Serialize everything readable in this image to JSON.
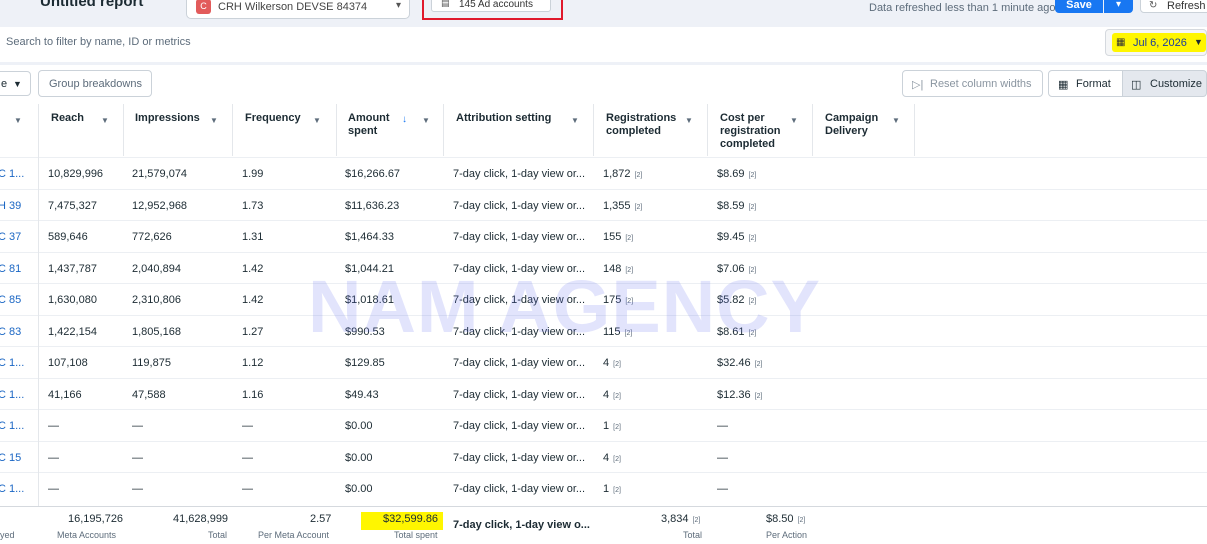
{
  "header": {
    "report_title": "Untitled report",
    "account_name": "CRH Wilkerson DEVSE 84374",
    "ad_accounts_label": "145 Ad accounts",
    "refresh_note": "Data refreshed less than 1 minute ago",
    "save_label": "Save",
    "refresh_label": "Refresh"
  },
  "filter": {
    "placeholder": "Search to filter by name, ID or metrics",
    "date_label": "Jul 6, 2026"
  },
  "toolbar": {
    "breakdown_label": "e",
    "group_breakdowns": "Group breakdowns",
    "reset_column_widths": "Reset column widths",
    "format": "Format",
    "customize": "Customize"
  },
  "columns": [
    {
      "label": "Reach"
    },
    {
      "label": "Impressions"
    },
    {
      "label": "Frequency"
    },
    {
      "label": "Amount spent"
    },
    {
      "label": "Attribution setting"
    },
    {
      "label": "Registrations completed"
    },
    {
      "label": "Cost per registration completed"
    },
    {
      "label": "Campaign Delivery"
    }
  ],
  "rows": [
    {
      "name": "C 1...",
      "reach": "10,829,996",
      "impressions": "21,579,074",
      "frequency": "1.99",
      "amount": "$16,266.67",
      "attribution": "7-day click, 1-day view or...",
      "registrations": "1,872",
      "cost": "$8.69"
    },
    {
      "name": "H 39",
      "reach": "7,475,327",
      "impressions": "12,952,968",
      "frequency": "1.73",
      "amount": "$11,636.23",
      "attribution": "7-day click, 1-day view or...",
      "registrations": "1,355",
      "cost": "$8.59"
    },
    {
      "name": "C 37",
      "reach": "589,646",
      "impressions": "772,626",
      "frequency": "1.31",
      "amount": "$1,464.33",
      "attribution": "7-day click, 1-day view or...",
      "registrations": "155",
      "cost": "$9.45"
    },
    {
      "name": "C 81",
      "reach": "1,437,787",
      "impressions": "2,040,894",
      "frequency": "1.42",
      "amount": "$1,044.21",
      "attribution": "7-day click, 1-day view or...",
      "registrations": "148",
      "cost": "$7.06"
    },
    {
      "name": "C 85",
      "reach": "1,630,080",
      "impressions": "2,310,806",
      "frequency": "1.42",
      "amount": "$1,018.61",
      "attribution": "7-day click, 1-day view or...",
      "registrations": "175",
      "cost": "$5.82"
    },
    {
      "name": "C 83",
      "reach": "1,422,154",
      "impressions": "1,805,168",
      "frequency": "1.27",
      "amount": "$990.53",
      "attribution": "7-day click, 1-day view or...",
      "registrations": "115",
      "cost": "$8.61"
    },
    {
      "name": "C 1...",
      "reach": "107,108",
      "impressions": "119,875",
      "frequency": "1.12",
      "amount": "$129.85",
      "attribution": "7-day click, 1-day view or...",
      "registrations": "4",
      "cost": "$32.46"
    },
    {
      "name": "C 1...",
      "reach": "41,166",
      "impressions": "47,588",
      "frequency": "1.16",
      "amount": "$49.43",
      "attribution": "7-day click, 1-day view or...",
      "registrations": "4",
      "cost": "$12.36"
    },
    {
      "name": "C 1...",
      "reach": "—",
      "impressions": "—",
      "frequency": "—",
      "amount": "$0.00",
      "attribution": "7-day click, 1-day view or...",
      "registrations": "1",
      "cost": "—"
    },
    {
      "name": "C 15",
      "reach": "—",
      "impressions": "—",
      "frequency": "—",
      "amount": "$0.00",
      "attribution": "7-day click, 1-day view or...",
      "registrations": "4",
      "cost": "—"
    },
    {
      "name": "C 1...",
      "reach": "—",
      "impressions": "—",
      "frequency": "—",
      "amount": "$0.00",
      "attribution": "7-day click, 1-day view or...",
      "registrations": "1",
      "cost": "—"
    }
  ],
  "footnote_marker": "[2]",
  "totals": {
    "first_label": "yed",
    "reach": "16,195,726",
    "reach_sub": "Meta Accounts",
    "impressions": "41,628,999",
    "impressions_sub": "Total",
    "frequency": "2.57",
    "frequency_sub": "Per Meta Account",
    "amount": "$32,599.86",
    "amount_sub": "Total spent",
    "attribution": "7-day click, 1-day view o...",
    "registrations": "3,834",
    "registrations_sub": "Total",
    "cost": "$8.50",
    "cost_sub": "Per Action"
  },
  "watermark": "NAM AGENCY",
  "colors": {
    "accent": "#1877f2",
    "highlight": "#fff600",
    "link": "#1a66c4",
    "red_frame": "#e0192c"
  }
}
